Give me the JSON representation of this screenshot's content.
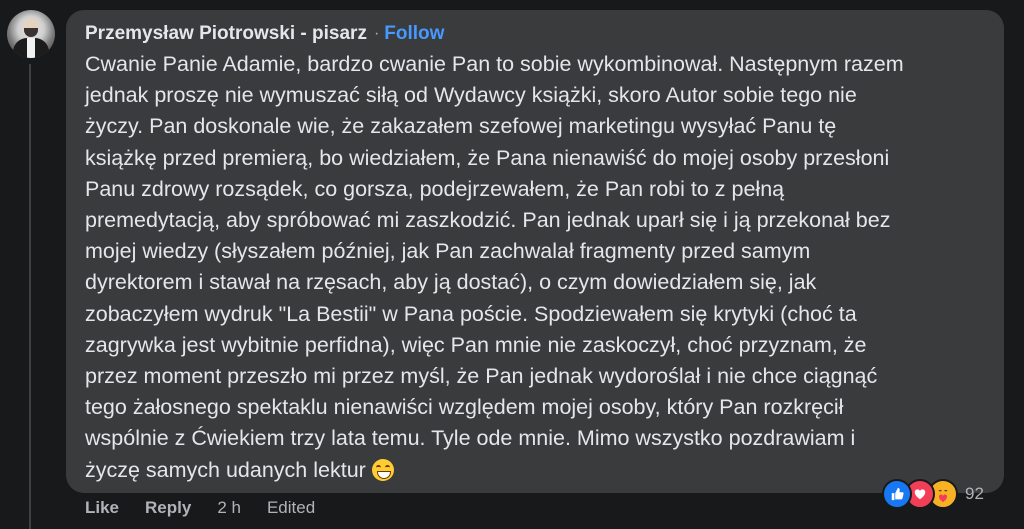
{
  "comment": {
    "author": "Przemysław Piotrowski - pisarz",
    "separator": "·",
    "follow_label": "Follow",
    "lines": [
      "Cwanie Panie Adamie, bardzo cwanie Pan to sobie wykombinował. Następnym razem",
      "jednak proszę nie wymuszać siłą od Wydawcy książki, skoro Autor sobie tego nie",
      "życzy. Pan doskonale wie, że zakazałem szefowej marketingu wysyłać Panu tę",
      "książkę przed premierą, bo wiedziałem, że Pana nienawiść do mojej osoby przesłoni",
      "Panu zdrowy rozsądek, co gorsza, podejrzewałem, że Pan robi to z pełną",
      "premedytacją, aby spróbować mi zaszkodzić. Pan jednak uparł się i ją przekonał bez",
      "mojej wiedzy (słyszałem później, jak Pan zachwalał fragmenty przed samym",
      "dyrektorem i stawał na rzęsach, aby ją dostać), o czym dowiedziałem się, jak",
      "zobaczyłem wydruk \"La Bestii\" w Pana poście. Spodziewałem się krytyki (choć ta",
      "zagrywka jest wybitnie perfidna), więc Pan mnie nie zaskoczył, choć przyznam, że",
      "przez moment przeszło mi przez myśl, że Pan jednak wydoroślał i nie chce ciągnąć",
      "tego żałosnego spektaklu nienawiści względem mojej osoby, który Pan rozkręcił",
      "wspólnie z Ćwiekiem trzy lata temu. Tyle ode mnie. Mimo wszystko pozdrawiam i",
      "życzę samych udanych lektur"
    ],
    "trailing_emoji": "grinning-face-emoji"
  },
  "actions": {
    "like_label": "Like",
    "reply_label": "Reply",
    "time": "2 h",
    "edited_label": "Edited"
  },
  "reactions": {
    "icons": [
      "like-reaction-icon",
      "love-reaction-icon",
      "care-reaction-icon"
    ],
    "count": "92"
  },
  "colors": {
    "background": "#18191a",
    "bubble": "#3a3b3c",
    "text": "#e4e6eb",
    "secondary_text": "#b0b3b8",
    "link": "#4599ff"
  }
}
